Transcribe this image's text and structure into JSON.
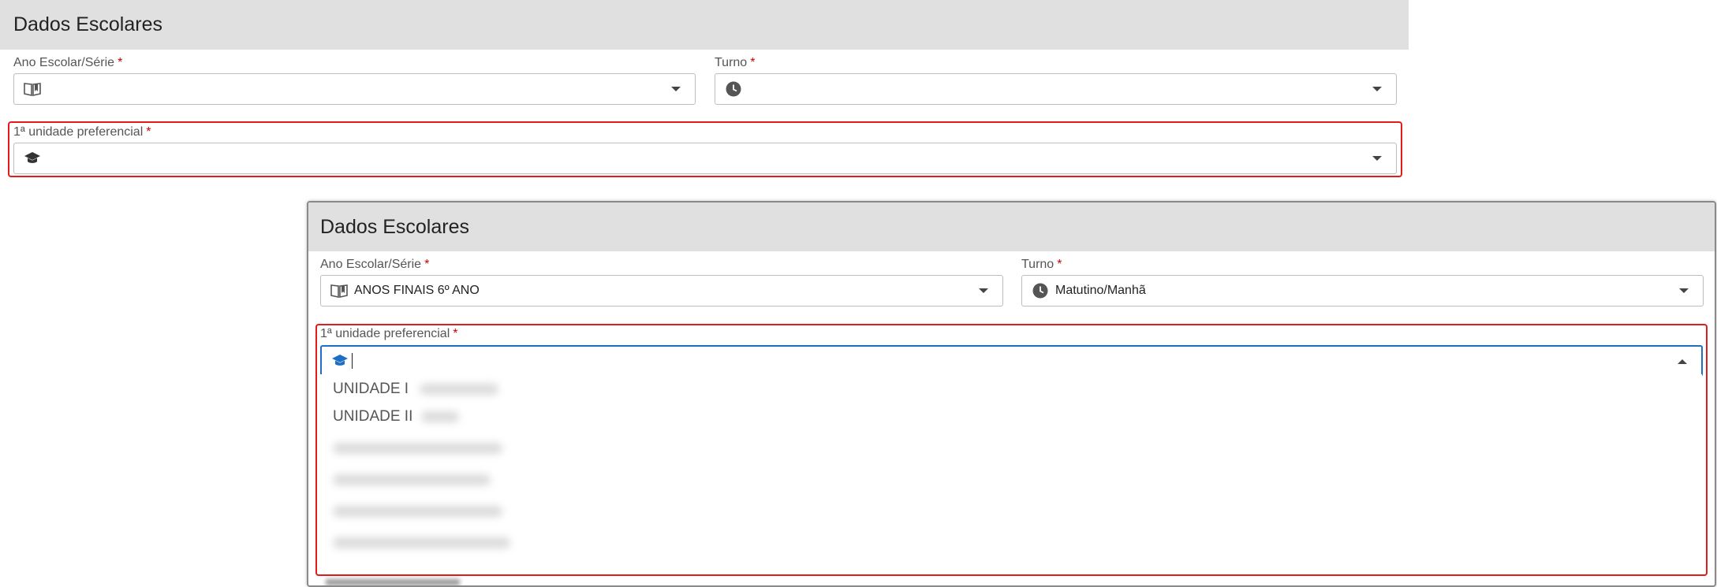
{
  "top_form": {
    "title": "Dados Escolares",
    "ano_label": "Ano Escolar/Série",
    "turno_label": "Turno",
    "unidade_label": "1ª unidade preferencial",
    "required_mark": "*"
  },
  "bottom_form": {
    "title": "Dados Escolares",
    "ano_label": "Ano Escolar/Série",
    "ano_value": "ANOS FINAIS 6º ANO",
    "turno_label": "Turno",
    "turno_value": "Matutino/Manhã",
    "unidade_label": "1ª unidade preferencial",
    "required_mark": "*",
    "options": [
      "UNIDADE I",
      "UNIDADE II"
    ]
  },
  "icons": {
    "ano": "book-open-icon",
    "turno": "clock-icon",
    "unidade": "graduation-cap-icon",
    "caret": "chevron-down-icon"
  },
  "colors": {
    "header_bg": "#e0e0e0",
    "required": "#c00000",
    "highlight": "#e21b1b",
    "focus": "#1e6fc4",
    "active_icon": "#1e6fc4"
  }
}
